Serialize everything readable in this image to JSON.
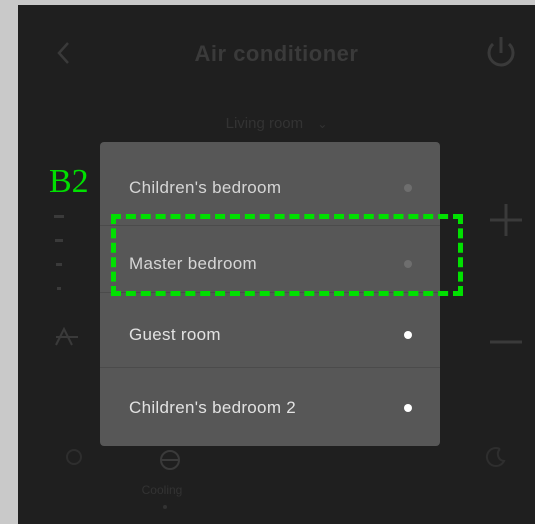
{
  "header": {
    "title": "Air conditioner",
    "back_icon": "chevron-left-icon",
    "power_icon": "power-icon"
  },
  "room_selector": {
    "selected": "Living room",
    "icon": "chevron-down-icon"
  },
  "dropdown": {
    "items": [
      {
        "label": "Children's bedroom",
        "text_color": "#d6d6d6",
        "dot_color": "#6e6e6e"
      },
      {
        "label": "Master bedroom",
        "text_color": "#d6d6d6",
        "dot_color": "#6e6e6e"
      },
      {
        "label": "Guest room",
        "text_color": "#e2e2e2",
        "dot_color": "#ffffff"
      },
      {
        "label": "Children's bedroom 2",
        "text_color": "#e2e2e2",
        "dot_color": "#ffffff"
      }
    ]
  },
  "controls": {
    "increase_icon": "plus-icon",
    "decrease_icon": "minus-icon",
    "fan_icon": "fan-speed-icon",
    "swing_icon": "swing-icon"
  },
  "mode": {
    "label": "Cooling",
    "icon": "cooling-mode-icon"
  },
  "annotation": {
    "label": "B2",
    "color": "#00e000"
  }
}
